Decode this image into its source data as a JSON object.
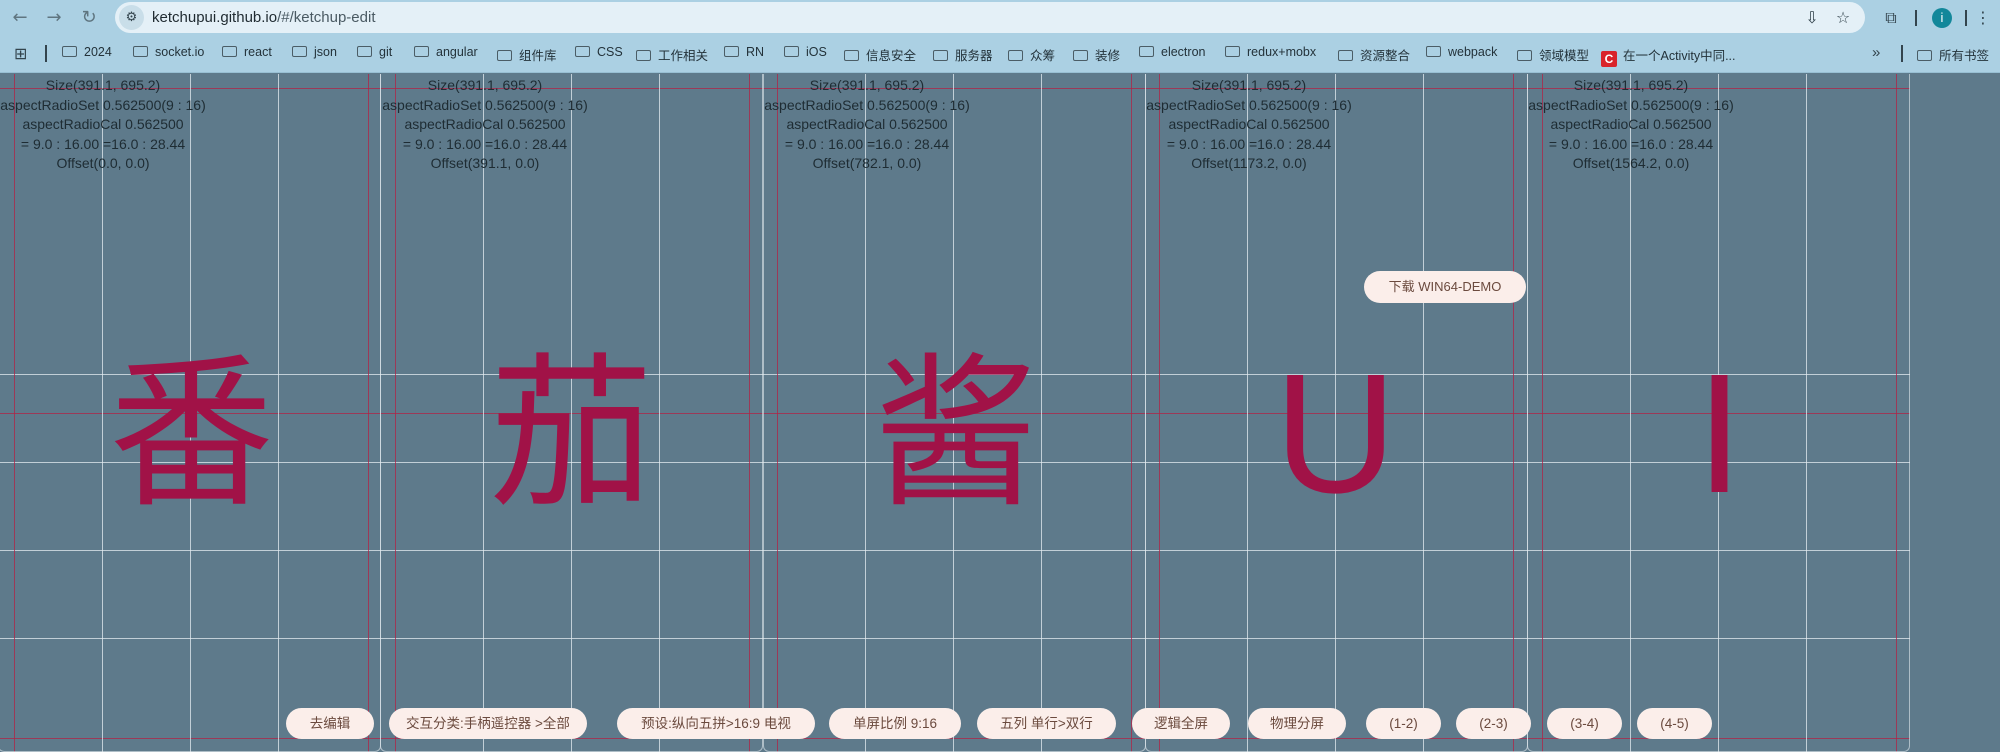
{
  "browser": {
    "url_host": "ketchupui.github.io",
    "url_path": "/#/ketchup-edit",
    "profile_initial": "i",
    "icons": {
      "back": "arrow-left-icon",
      "forward": "arrow-right-icon",
      "reload": "reload-icon",
      "site_settings": "tune-icon",
      "install": "install-app-icon",
      "bookmark_star": "star-icon",
      "extensions": "puzzle-icon"
    }
  },
  "bookmarks": {
    "items": [
      {
        "label": "2024",
        "icon": "folder-icon"
      },
      {
        "label": "socket.io",
        "icon": "folder-icon"
      },
      {
        "label": "react",
        "icon": "folder-icon"
      },
      {
        "label": "json",
        "icon": "folder-icon"
      },
      {
        "label": "git",
        "icon": "folder-icon"
      },
      {
        "label": "angular",
        "icon": "folder-icon"
      },
      {
        "label": "组件库",
        "icon": "folder-icon"
      },
      {
        "label": "CSS",
        "icon": "folder-icon"
      },
      {
        "label": "工作相关",
        "icon": "folder-icon"
      },
      {
        "label": "RN",
        "icon": "folder-icon"
      },
      {
        "label": "iOS",
        "icon": "folder-icon"
      },
      {
        "label": "信息安全",
        "icon": "folder-icon"
      },
      {
        "label": "服务器",
        "icon": "folder-icon"
      },
      {
        "label": "众筹",
        "icon": "folder-icon"
      },
      {
        "label": "装修",
        "icon": "folder-icon"
      },
      {
        "label": "electron",
        "icon": "folder-icon"
      },
      {
        "label": "redux+mobx",
        "icon": "folder-icon"
      },
      {
        "label": "资源整合",
        "icon": "folder-icon"
      },
      {
        "label": "webpack",
        "icon": "folder-icon"
      },
      {
        "label": "领域模型",
        "icon": "folder-icon"
      },
      {
        "label": "在一个Activity中同...",
        "icon": "csdn-icon"
      }
    ],
    "more": "»",
    "all_bookmarks": "所有书签"
  },
  "panels": [
    {
      "size": "Size(391.1, 695.2)",
      "ratio_set": "aspectRadioSet 0.562500(9 : 16)",
      "ratio_cal": "aspectRadioCal 0.562500",
      "equation": "= 9.0 : 16.00 =16.0 : 28.44",
      "offset": "Offset(0.0, 0.0)",
      "glyph": "番"
    },
    {
      "size": "Size(391.1, 695.2)",
      "ratio_set": "aspectRadioSet 0.562500(9 : 16)",
      "ratio_cal": "aspectRadioCal 0.562500",
      "equation": "= 9.0 : 16.00 =16.0 : 28.44",
      "offset": "Offset(391.1, 0.0)",
      "glyph": "茄"
    },
    {
      "size": "Size(391.1, 695.2)",
      "ratio_set": "aspectRadioSet 0.562500(9 : 16)",
      "ratio_cal": "aspectRadioCal 0.562500",
      "equation": "= 9.0 : 16.00 =16.0 : 28.44",
      "offset": "Offset(782.1, 0.0)",
      "glyph": "酱"
    },
    {
      "size": "Size(391.1, 695.2)",
      "ratio_set": "aspectRadioSet 0.562500(9 : 16)",
      "ratio_cal": "aspectRadioCal 0.562500",
      "equation": "= 9.0 : 16.00 =16.0 : 28.44",
      "offset": "Offset(1173.2, 0.0)",
      "glyph": "U"
    },
    {
      "size": "Size(391.1, 695.2)",
      "ratio_set": "aspectRadioSet 0.562500(9 : 16)",
      "ratio_cal": "aspectRadioCal 0.562500",
      "equation": "= 9.0 : 16.00 =16.0 : 28.44",
      "offset": "Offset(1564.2, 0.0)",
      "glyph": "I"
    }
  ],
  "download_button": "下载 WIN64-DEMO",
  "toolbar": {
    "buttons": [
      "去编辑",
      "交互分类:手柄遥控器 >全部",
      "预设:纵向五拼>16:9 电视",
      "单屏比例 9:16",
      "五列 单行>双行",
      "逻辑全屏",
      "物理分屏",
      "(1-2)",
      "(2-3)",
      "(3-4)",
      "(4-5)"
    ]
  },
  "colors": {
    "background": "#5e7a8b",
    "chrome": "#abd0e3",
    "glyph": "#a11247",
    "button_bg": "#fbeeea",
    "button_text": "#6b4a3e",
    "grid_white": "#e4ecf0",
    "grid_red": "#b02446"
  }
}
